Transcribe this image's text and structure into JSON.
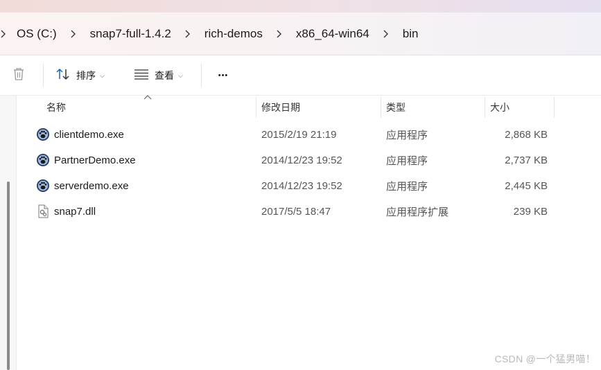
{
  "window": {
    "accent": "#0067c0"
  },
  "breadcrumb": {
    "items": [
      {
        "label": "OS (C:)"
      },
      {
        "label": "snap7-full-1.4.2"
      },
      {
        "label": "rich-demos"
      },
      {
        "label": "x86_64-win64"
      },
      {
        "label": "bin"
      }
    ]
  },
  "toolbar": {
    "delete_icon": "trash-icon",
    "sort_label": "排序",
    "view_label": "查看",
    "more_label": "•••"
  },
  "columns": {
    "name": "名称",
    "date": "修改日期",
    "type": "类型",
    "size": "大小"
  },
  "files": [
    {
      "name": "clientdemo.exe",
      "date": "2015/2/19 21:19",
      "type": "应用程序",
      "size": "2,868 KB",
      "icon": "app-icon"
    },
    {
      "name": "PartnerDemo.exe",
      "date": "2014/12/23 19:52",
      "type": "应用程序",
      "size": "2,737 KB",
      "icon": "app-icon"
    },
    {
      "name": "serverdemo.exe",
      "date": "2014/12/23 19:52",
      "type": "应用程序",
      "size": "2,445 KB",
      "icon": "app-icon"
    },
    {
      "name": "snap7.dll",
      "date": "2017/5/5 18:47",
      "type": "应用程序扩展",
      "size": "239 KB",
      "icon": "dll-icon"
    }
  ],
  "watermark": "CSDN @一个猛男喵！"
}
